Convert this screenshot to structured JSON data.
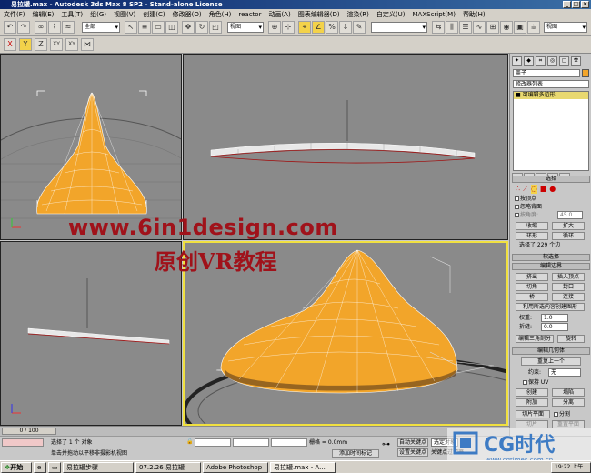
{
  "window": {
    "title": "易拉罐.max - Autodesk 3ds Max 8 SP2  -  Stand-alone License"
  },
  "menu": [
    "文件(F)",
    "编辑(E)",
    "工具(T)",
    "组(G)",
    "视图(V)",
    "创建(C)",
    "修改器(O)",
    "角色(H)",
    "reactor",
    "动画(A)",
    "图表编辑器(D)",
    "渲染(R)",
    "自定义(U)",
    "MAXScript(M)",
    "帮助(H)"
  ],
  "toolbar": {
    "selection_filter": "全部",
    "ref_coord": "视图",
    "named_sel": "视图"
  },
  "axis_constraints": [
    "X",
    "Y",
    "Z",
    "XY",
    "XY"
  ],
  "watermark": {
    "url": "www.6in1design.com",
    "title": "原创VR教程"
  },
  "panel": {
    "object_name": "盖子",
    "modifier_list": "修改器列表",
    "stack_item": "可编辑多边形",
    "rollout_selection": "选择",
    "sel_options": [
      "按顶点",
      "忽略背面",
      "按角度:"
    ],
    "angle_value": "45.0",
    "shrink": "收缩",
    "grow": "扩大",
    "ring": "环形",
    "loop": "循环",
    "selected_status": "选择了 229 个边",
    "rollout_soft": "软选择",
    "rollout_edit_edges": "编辑边界",
    "extrude": "挤出",
    "insert_vertex": "插入顶点",
    "chamfer": "切角",
    "cap": "封口",
    "bridge": "桥",
    "connect": "连接",
    "create_shape": "利用所选内容创建图形",
    "weight_label": "权重:",
    "weight_value": "1.0",
    "crease_label": "折缝:",
    "crease_value": "0.0",
    "edit_tri": "编辑三角剖分",
    "turn": "旋转",
    "rollout_geometry": "编辑几何体",
    "repeat_last": "重复上一个",
    "constraints_label": "约束:",
    "constraints_value": "无",
    "preserve_uvs": "保持 UV",
    "create": "创建",
    "collapse": "塌陷",
    "attach": "附加",
    "detach": "分离",
    "slice_plane": "切片平面",
    "split": "分割",
    "slice": "切片",
    "reset_plane": "重置平面"
  },
  "timeline": {
    "frame": "0 / 100"
  },
  "status": {
    "selected": "选择了 1 个 对象",
    "prompt": "单击并拖动以平移非摄影机视图",
    "grid": "栅格 = 0.0mm",
    "add_time_tag": "添加时间标记",
    "auto_key": "自动关键点",
    "set_key": "设置关键点",
    "selected_obj": "选定对象",
    "key_filters": "关键点过滤器..."
  },
  "taskbar": {
    "start": "开始",
    "items": [
      "易拉罐步骤",
      "07.2.26 易拉罐",
      "Adobe Photoshop",
      "易拉罐.max - A..."
    ],
    "clock": "19:22 上午"
  },
  "logo": {
    "text": "CG时代",
    "url": "www.cgtimes.com.cn"
  },
  "colors": {
    "shape": "#f2a52a",
    "accent_red": "#a0121a",
    "title_bar": "#0a246a"
  }
}
